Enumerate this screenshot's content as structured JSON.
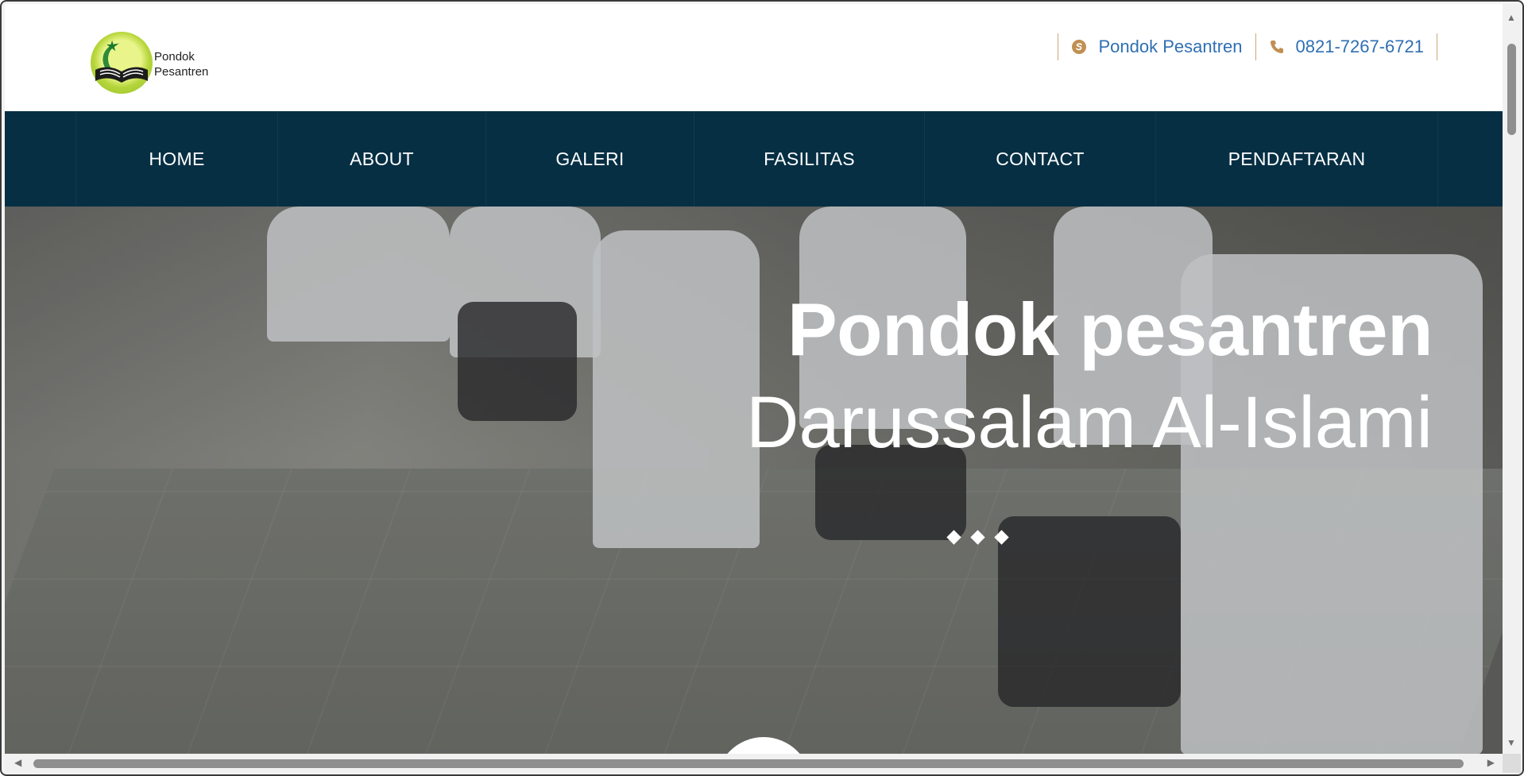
{
  "header": {
    "logo_line1": "Pondok",
    "logo_line2": "Pesantren",
    "skype_label": "Pondok Pesantren",
    "skype_icon": "skype-icon",
    "phone_label": "0821-7267-6721",
    "phone_icon": "phone-icon"
  },
  "nav": {
    "items": [
      {
        "label": "HOME"
      },
      {
        "label": "ABOUT"
      },
      {
        "label": "GALERI"
      },
      {
        "label": "FASILITAS"
      },
      {
        "label": "CONTACT"
      },
      {
        "label": "PENDAFTARAN"
      }
    ]
  },
  "hero": {
    "title": "Pondok pesantren",
    "subtitle": "Darussalam Al-Islami",
    "slide_count": 3
  },
  "colors": {
    "nav_background": "#062f44",
    "link_blue": "#2f6fb3",
    "icon_tan": "#c08f52",
    "logo_green": "#b6d53b"
  }
}
